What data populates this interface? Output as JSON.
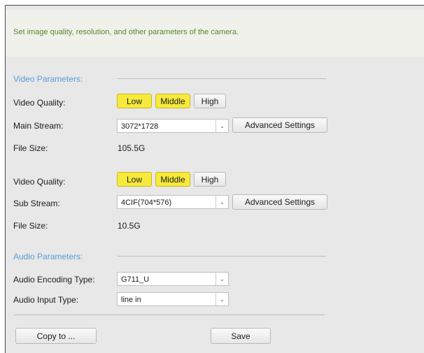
{
  "banner": {
    "text": "Set image quality, resolution, and other parameters of the camera."
  },
  "video": {
    "section_title": "Video Parameters:",
    "main": {
      "quality_label": "Video Quality:",
      "quality_options": [
        "Low",
        "Middle",
        "High"
      ],
      "stream_label": "Main Stream:",
      "stream_value": "3072*1728",
      "advanced_label": "Advanced Settings",
      "filesize_label": "File Size:",
      "filesize_value": "105.5G"
    },
    "sub": {
      "quality_label": "Video Quality:",
      "quality_options": [
        "Low",
        "Middle",
        "High"
      ],
      "stream_label": "Sub Stream:",
      "stream_value": "4CIF(704*576)",
      "advanced_label": "Advanced Settings",
      "filesize_label": "File Size:",
      "filesize_value": "10.5G"
    }
  },
  "audio": {
    "section_title": "Audio Parameters:",
    "encoding_label": "Audio Encoding Type:",
    "encoding_value": "G711_U",
    "input_label": "Audio Input Type:",
    "input_value": "line in"
  },
  "footer": {
    "copy_label": "Copy to ...",
    "save_label": "Save"
  },
  "colors": {
    "selected_button": "#f7ea3c",
    "section_title": "#5b9bd6",
    "banner_text": "#4e8a2c"
  },
  "icons": {
    "dropdown": "chevron-down-icon"
  }
}
